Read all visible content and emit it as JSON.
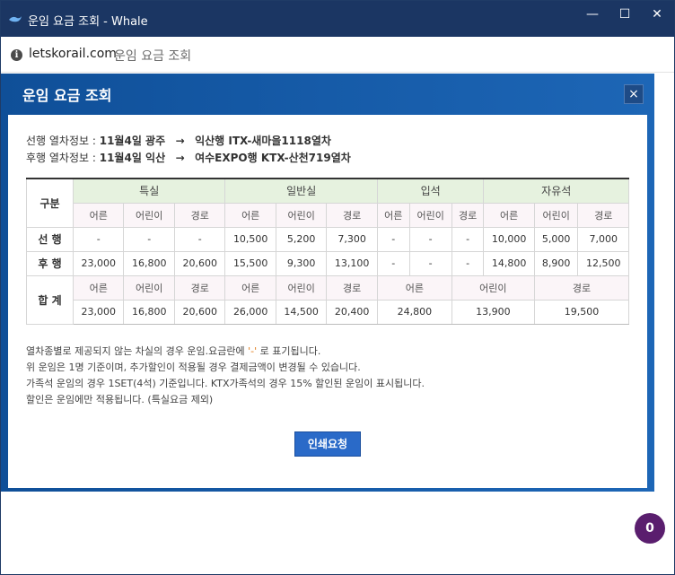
{
  "window": {
    "title": "운임 요금 조회 - Whale",
    "controls": {
      "minimize": "—",
      "maximize": "☐",
      "close": "✕"
    },
    "accent_color": "#1b3663"
  },
  "addressbar": {
    "domain": "letskorail.com",
    "page_title": "운임 요금 조회",
    "info_icon": "i"
  },
  "modal": {
    "title": "운임 요금 조회",
    "close": "×",
    "route1": {
      "label": "선행 열차정보 : ",
      "date_place": "11월4일 광주",
      "arrow": "→",
      "train": "익산행 ITX-새마을1118열차"
    },
    "route2": {
      "label": "후행 열차정보 : ",
      "date_place": "11월4일 익산",
      "arrow": "→",
      "train": "여수EXPO행 KTX-산천719열차"
    },
    "table": {
      "gubun": "구분",
      "classes": [
        "특실",
        "일반실",
        "입석",
        "자유석"
      ],
      "types": [
        "어른",
        "어린이",
        "경로"
      ],
      "rows": [
        {
          "label": "선 행",
          "values": [
            "-",
            "-",
            "-",
            "10,500",
            "5,200",
            "7,300",
            "-",
            "-",
            "-",
            "10,000",
            "5,000",
            "7,000"
          ]
        },
        {
          "label": "후 행",
          "values": [
            "23,000",
            "16,800",
            "20,600",
            "15,500",
            "9,300",
            "13,100",
            "-",
            "-",
            "-",
            "14,800",
            "8,900",
            "12,500"
          ]
        }
      ],
      "total": {
        "label": "합 계",
        "sub_labels": [
          "어른",
          "어린이",
          "경로",
          "어른",
          "어린이",
          "경로"
        ],
        "wide_labels": [
          "어른",
          "어린이",
          "경로"
        ],
        "values": [
          "23,000",
          "16,800",
          "20,600",
          "26,000",
          "14,500",
          "20,400"
        ],
        "wide_values": [
          "24,800",
          "13,900",
          "19,500"
        ]
      }
    },
    "notes": {
      "line1_a": "열차종별로 제공되지 않는 차실의 경우 운임.요금란에 ",
      "line1_hl": "'-'",
      "line1_b": " 로 표기됩니다.",
      "line2": "위 운임은 1명 기준이며, 추가할인이 적용될 경우 결제금액이 변경될 수 있습니다.",
      "line3": "가족석 운임의 경우 1SET(4석) 기준입니다. KTX가족석의 경우 15% 할인된 운임이 표시됩니다.",
      "line4": "할인은 운임에만 적용됩니다. (특실요금 제외)"
    },
    "print_button": "인쇄요청"
  },
  "fab": {
    "label": "0",
    "color": "#5a1e6e"
  }
}
